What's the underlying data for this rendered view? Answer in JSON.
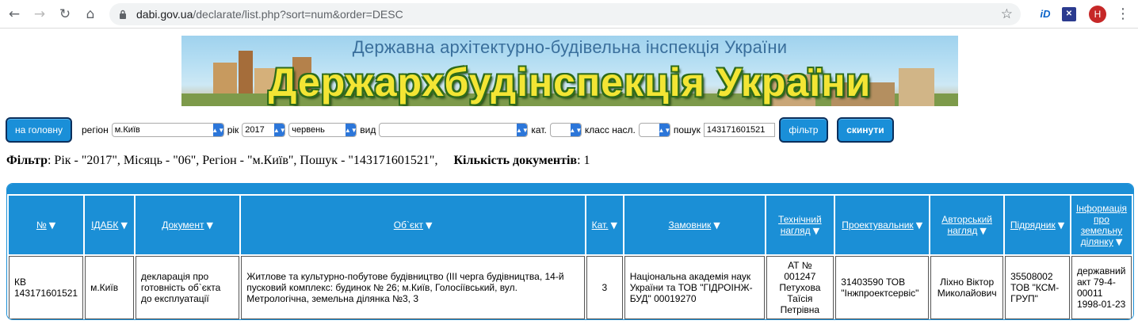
{
  "browser": {
    "url_host": "dabi.gov.ua",
    "url_rest": "/declarate/list.php?sort=num&order=DESC",
    "ext_id_label": "iD",
    "avatar_letter": "H"
  },
  "banner": {
    "subtitle": "Державна архітектурно-будівельна інспекція України",
    "title": "Держархбудінспекція України"
  },
  "filters": {
    "home_button": "на головну",
    "region_label": "регіон",
    "region_value": "м.Київ",
    "year_label": "рік",
    "year_value": "2017",
    "month_value": "червень",
    "kind_label": "вид",
    "kind_value": "",
    "cat_label": "кат.",
    "cat_value": "",
    "class_label": "класс насл.",
    "class_value": "",
    "search_label": "пошук",
    "search_value": "143171601521",
    "filter_button": "фільтр",
    "reset_button": "скинути"
  },
  "filter_summary": {
    "filter_label": "Фільтр",
    "filter_text": ": Рік - \"2017\", Місяць - \"06\", Регіон - \"м.Київ\", Пошук - \"143171601521\",",
    "count_label": "Кількість документів",
    "count_text": ": 1"
  },
  "table": {
    "headers": [
      "№",
      "ІДАБК",
      "Документ",
      "Об`єкт",
      "Кат.",
      "Замовник",
      "Технічний нагляд",
      "Проектувальник",
      "Авторський нагляд",
      "Підрядник",
      "Інформація про земельну ділянку"
    ],
    "sort_icon": "▼",
    "rows": [
      [
        "КВ 143171601521",
        "м.Київ",
        "декларація про готовність об`єкта до експлуатації",
        "Житлове та культурно-побутове будівництво (III черга будівництва, 14-й пусковий комплекс: будинок № 26; м.Київ, Голосіївський, вул. Метрологічна, земельна ділянка №3, 3",
        "3",
        "Національна академія наук України та ТОВ \"ГІДРОІНЖ-БУД\" 00019270",
        "АТ № 001247 Петухова Таїсія Петрівна",
        "31403590 ТОВ \"Інжпроектсервіс\"",
        "Ліхно Віктор Миколайович",
        "35508002 ТОВ \"КСМ-ГРУП\"",
        "державний акт 79-4-00011 1998-01-23"
      ]
    ]
  }
}
